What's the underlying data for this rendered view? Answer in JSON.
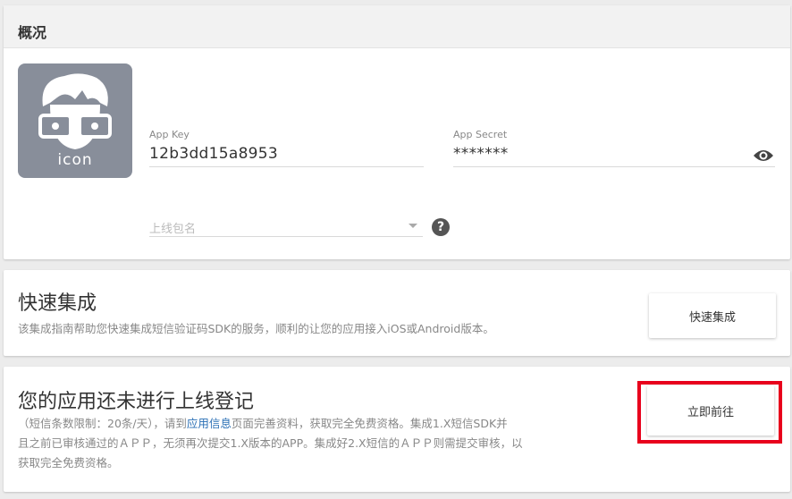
{
  "overview": {
    "header": "概况",
    "icon_text": "icon",
    "app_key": {
      "label": "App Key",
      "value": "12b3dd15a8953"
    },
    "app_secret": {
      "label": "App Secret",
      "value": "*******"
    },
    "package_select": {
      "placeholder": "上线包名"
    },
    "help_symbol": "?"
  },
  "quick_integration": {
    "title": "快速集成",
    "description": "该集成指南帮助您快速集成短信验证码SDK的服务，顺利的让您的应用接入iOS或Android版本。",
    "button_label": "快速集成"
  },
  "registration": {
    "title": "您的应用还未进行上线登记",
    "desc_part1": "（短信条数限制：20条/天），请到",
    "desc_link": "应用信息",
    "desc_part2": "页面完善资料，获取完全免费资格。集成1.X短信SDK并",
    "desc_line2": "且之前已审核通过的ＡＰＰ，无须再次提交1.X版本的APP。集成好2.X短信的ＡＰＰ则需提交审核，以",
    "desc_line3": "获取完全免费资格。",
    "button_label": "立即前往"
  },
  "colors": {
    "highlight": "#e8001c",
    "link": "#2a6fb5",
    "icon_bg": "#888e9a"
  }
}
